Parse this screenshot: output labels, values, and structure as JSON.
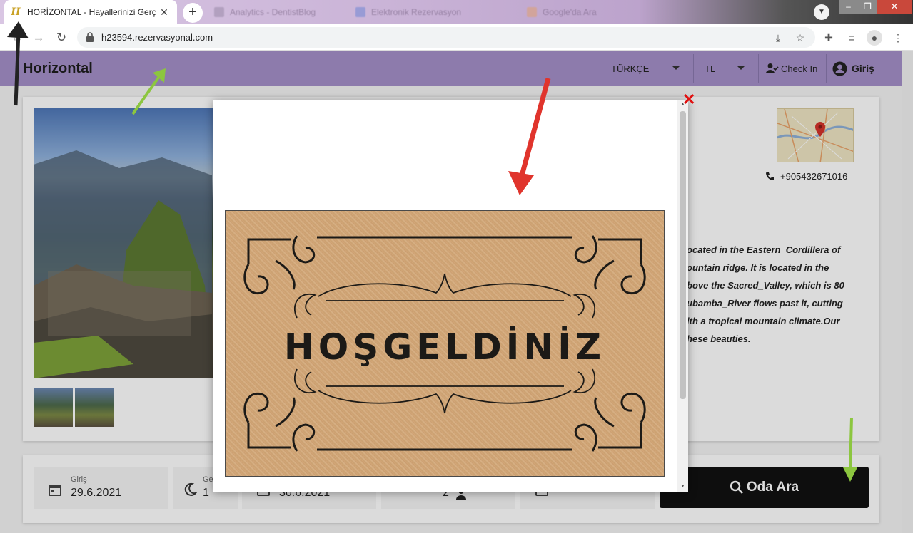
{
  "browser": {
    "active_tab": {
      "title": "HORİZONTAL - Hayallerinizi Gerç",
      "favicon": "H",
      "close": "✕"
    },
    "inactive_tabs": [
      {
        "title": "Analytics - DentistBlog"
      },
      {
        "title": "Elektronik Rezervasyon"
      },
      {
        "title": "Google'da Ara"
      }
    ],
    "new_tab": "+",
    "url": "h23594.rezervasyonal.com"
  },
  "site": {
    "brand": "Horizontal",
    "language": "TÜRKÇE",
    "currency": "TL",
    "checkin": "Check In",
    "login": "Giriş",
    "phone": "+905432671016",
    "description_lines": [
      "ocated in the Eastern_Cordillera of",
      "ountain ridge. It is located in the",
      "bove the Sacred_Valley, which is 80",
      "ubamba_River flows past it, cutting",
      "ith a tropical mountain climate.Our",
      "hese beauties."
    ]
  },
  "search": {
    "checkin_label": "Giriş",
    "checkin_value": "29.6.2021",
    "nights_label": "Ge",
    "nights_value": "1",
    "checkout_value": "30.6.2021",
    "guests_value": "2",
    "button": "Oda Ara"
  },
  "modal": {
    "close": "✕",
    "welcome_text": "HOŞGELDİNİZ"
  },
  "colors": {
    "header": "#a590c9",
    "search_button": "#111111",
    "arrow_red": "#e0342c",
    "arrow_green": "#8cc63f",
    "arrow_black": "#222222"
  }
}
